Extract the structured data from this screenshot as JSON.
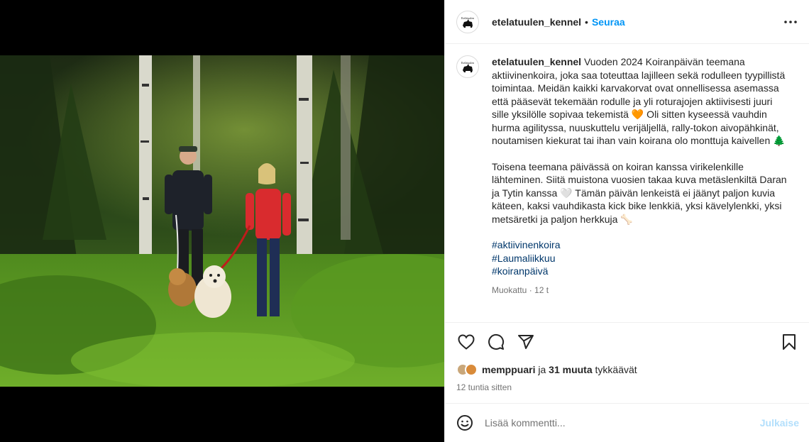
{
  "post": {
    "username": "etelatuulen_kennel",
    "follow_label": "Seuraa",
    "separator": "•",
    "caption_p1": "Vuoden 2024 Koiranpäivän teemana aktiivinenkoira, joka saa toteuttaa lajilleen sekä rodulleen tyypillistä toimintaa. Meidän kaikki karvakorvat ovat onnellisessa asemassa että pääsevät tekemään rodulle ja yli roturajojen aktiivisesti juuri sille yksilölle sopivaa tekemistä 🧡 Oli sitten kyseessä vauhdin hurma agilityssa, nuuskuttelu verijäljellä, rally-tokon aivopähkinät, noutamisen kiekurat tai ihan vain koirana olo monttuja kaivellen 🌲",
    "caption_p2": "Toisena teemana päivässä on koiran kanssa virikelenkille lähteminen. Siitä muistona vuosien takaa kuva metäslenkiltä Daran ja Tytin kanssa 🤍 Tämän päivän lenkeistä ei jäänyt paljon kuvia käteen, kaksi vauhdikasta kick bike lenkkiä, yksi kävelylenkki, yksi metsäretki ja paljon herkkuja 🦴",
    "hashtags": [
      "#aktiivinenkoira",
      "#Laumaliikkuu",
      "#koiranpäivä"
    ],
    "edited": "Muokattu · 12 t"
  },
  "likes": {
    "liker": "memppuari",
    "connector": "ja",
    "others": "31 muuta",
    "suffix": "tykkäävät"
  },
  "time_ago": "12 tuntia sitten",
  "comment": {
    "placeholder": "Lisää kommentti...",
    "publish_label": "Julkaise"
  },
  "avatar_text": "Etelätuulen",
  "colors": {
    "link": "#0095f6",
    "hashtag": "#00376b",
    "muted": "#737373",
    "publish_disabled": "#b2dffc"
  },
  "icons": [
    "more-icon",
    "heart-icon",
    "comment-icon",
    "share-icon",
    "bookmark-icon",
    "emoji-icon"
  ]
}
